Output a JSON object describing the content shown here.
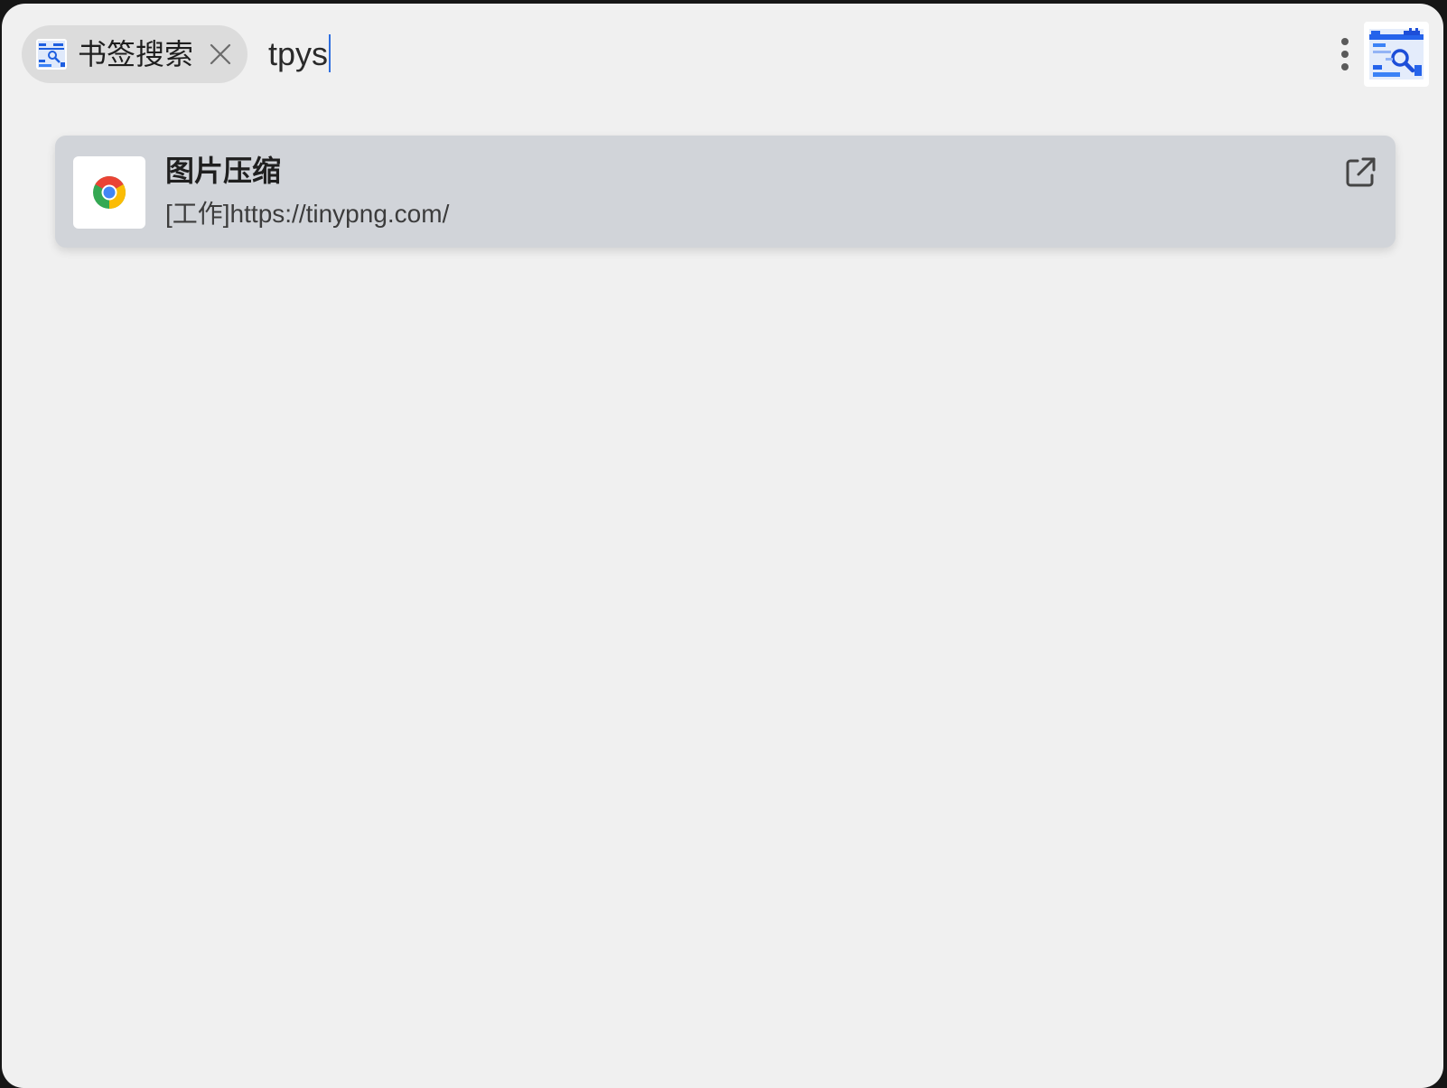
{
  "search": {
    "scope_chip": {
      "label": "书签搜索",
      "icon": "bookmark-search-icon"
    },
    "query": "tpys",
    "more_icon": "more-vertical-icon",
    "app_logo_icon": "bookmark-search-logo-icon"
  },
  "results": [
    {
      "title": "图片压缩",
      "subtitle": "[工作]https://tinypng.com/",
      "favicon": "chrome-icon",
      "action_icon": "open-external-icon"
    }
  ],
  "colors": {
    "window_bg": "#f0f0f0",
    "chip_bg": "#dcdcdc",
    "result_bg": "#d1d4d9",
    "caret": "#2f6fe0",
    "brand_blue": "#2563eb"
  }
}
